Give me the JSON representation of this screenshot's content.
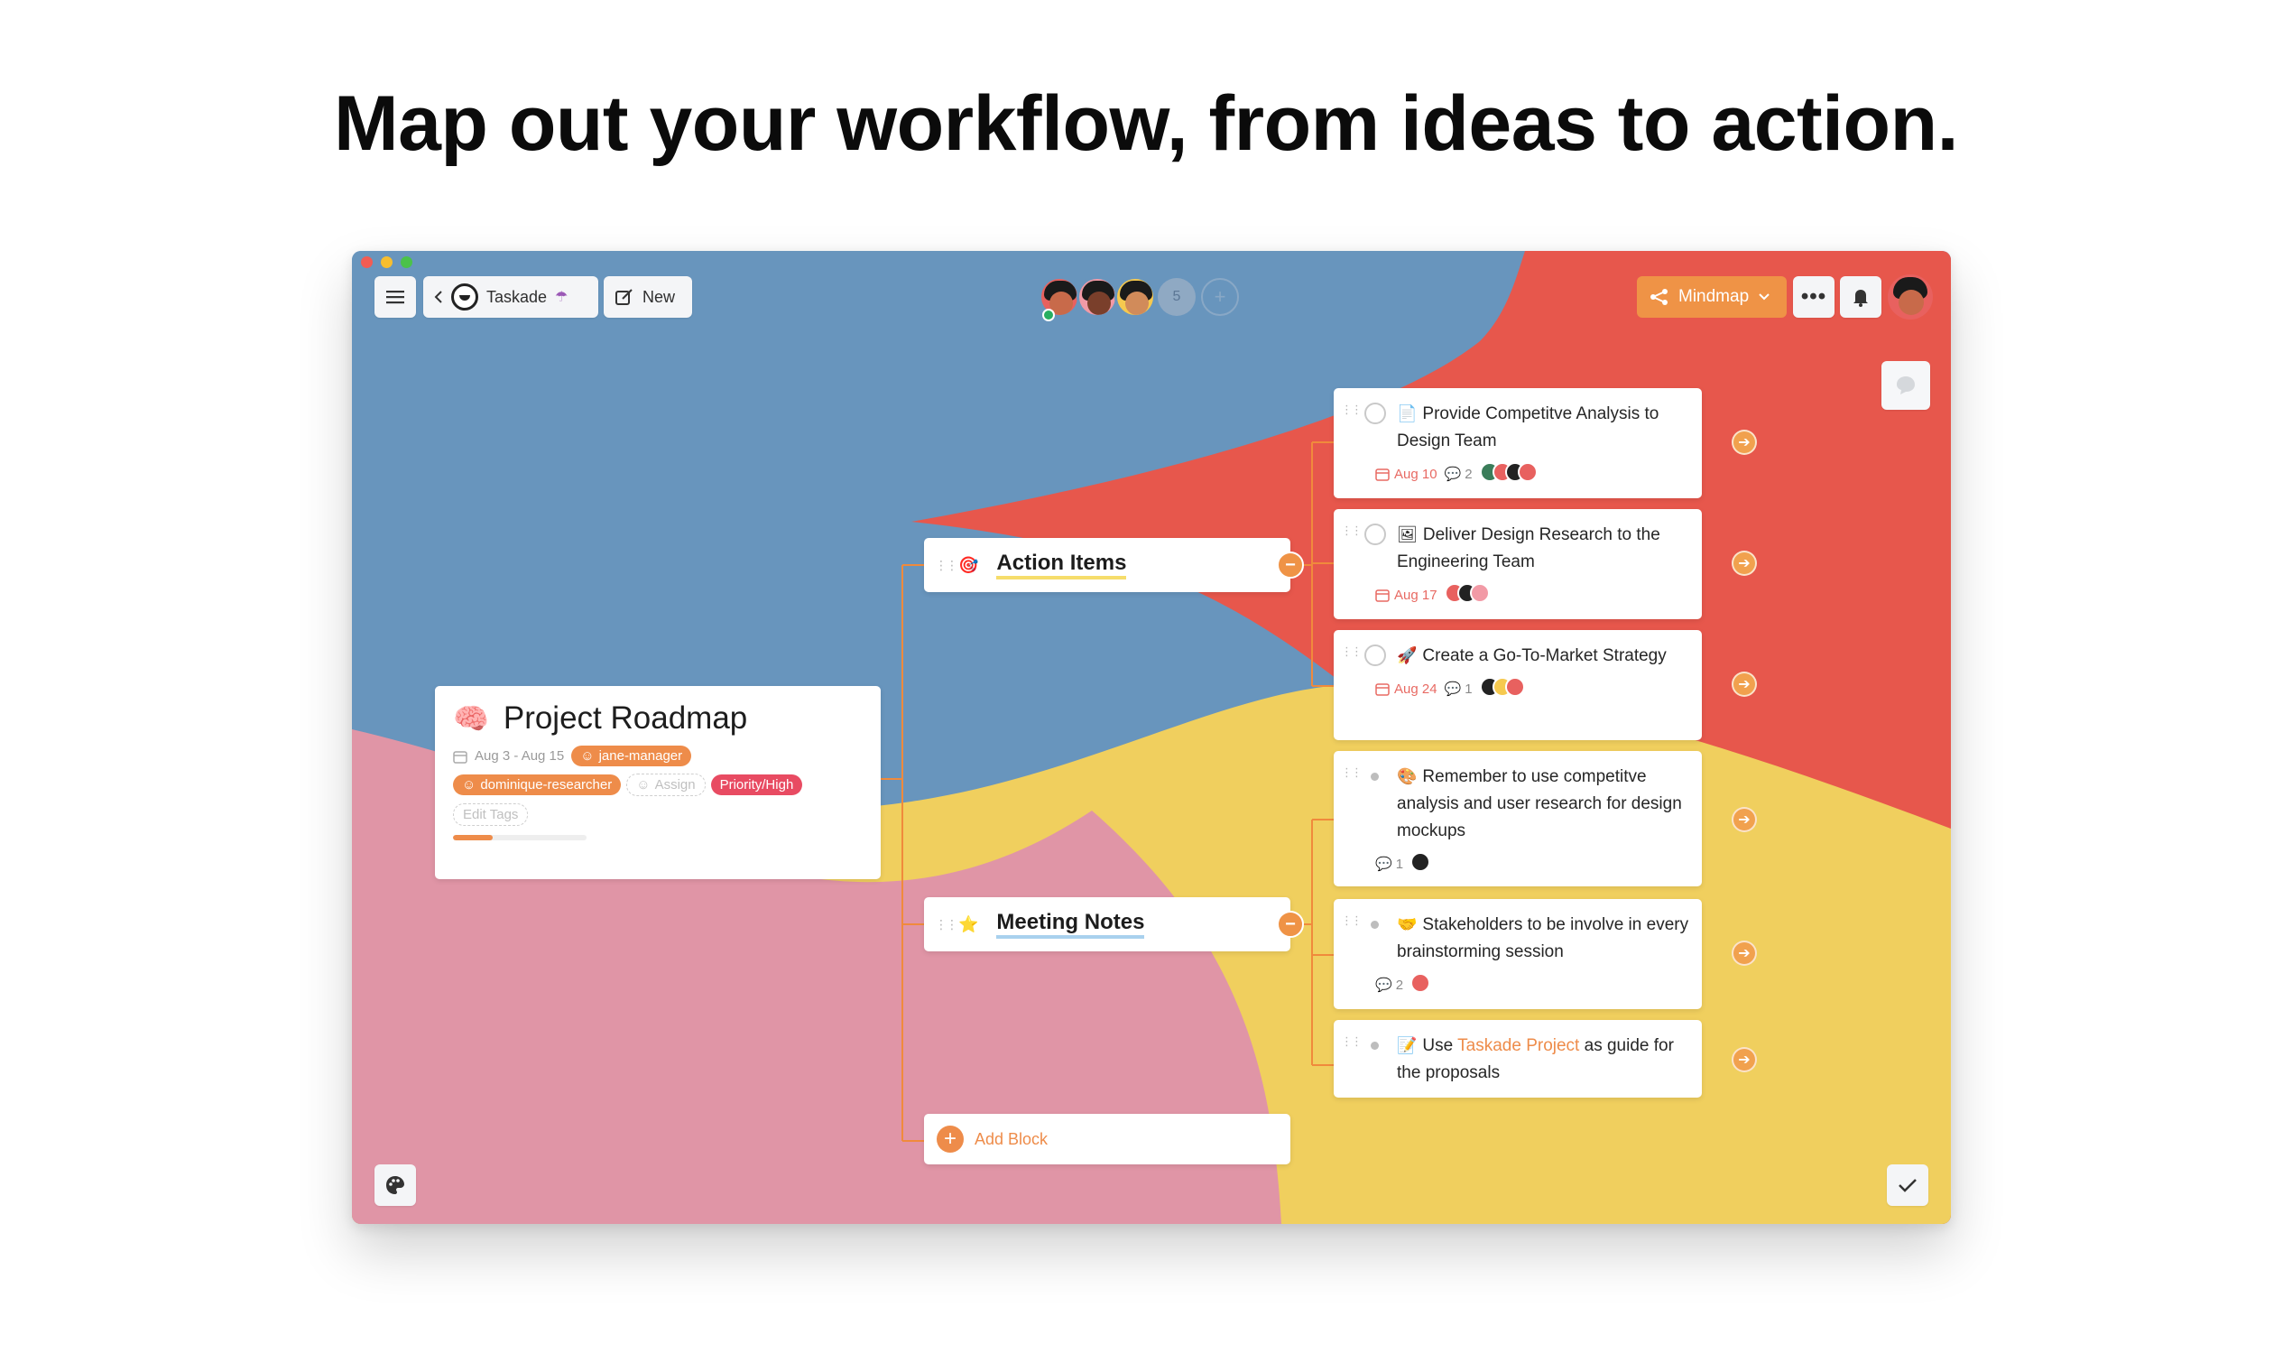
{
  "headline": "Map out your workflow, from ideas to action.",
  "toolbar": {
    "breadcrumb_label": "Taskade",
    "new_label": "New",
    "collaborator_count": "5",
    "add_collaborator": "+",
    "view_label": "Mindmap"
  },
  "root": {
    "title": "Project Roadmap",
    "dates": "Aug 3 - Aug 15",
    "assignee_1": "jane-manager",
    "assignee_2": "dominique-researcher",
    "assign_label": "Assign",
    "priority_tag": "Priority/High",
    "edit_tags_label": "Edit Tags",
    "progress_percent": 30
  },
  "branches": {
    "action_items": "Action Items",
    "meeting_notes": "Meeting Notes",
    "add_block": "Add Block"
  },
  "tasks": [
    {
      "text": "Provide Competitve Analysis to Design Team",
      "due": "Aug 10",
      "comments": "2"
    },
    {
      "text": "Deliver Design Research to the Engineering Team",
      "due": "Aug 17"
    },
    {
      "text": "Create a Go-To-Market Strategy",
      "due": "Aug 24",
      "comments": "1"
    }
  ],
  "notes": [
    {
      "text": "Remember to use competitve analysis and user research for design mockups",
      "comments": "1"
    },
    {
      "text": "Stakeholders to be involve in every brainstorming session",
      "comments": "2"
    },
    {
      "text_before": "Use",
      "link": "Taskade Project",
      "text_after": "as guide for the proposals"
    }
  ],
  "colors": {
    "blue_bg": "#6895bd",
    "red_bg": "#e7574c",
    "yellow_bg": "#f0cf5e",
    "pink_bg": "#e095a6",
    "accent_orange": "#ef9346",
    "priority_red": "#e84b62"
  },
  "icons": {
    "menu": "hamburger-icon",
    "back": "chevron-left-icon",
    "new": "compose-icon",
    "mindmap": "mindmap-icon",
    "more": "ellipsis-icon",
    "bell": "bell-icon",
    "chat": "chat-icon",
    "palette": "palette-icon",
    "check": "check-icon"
  }
}
